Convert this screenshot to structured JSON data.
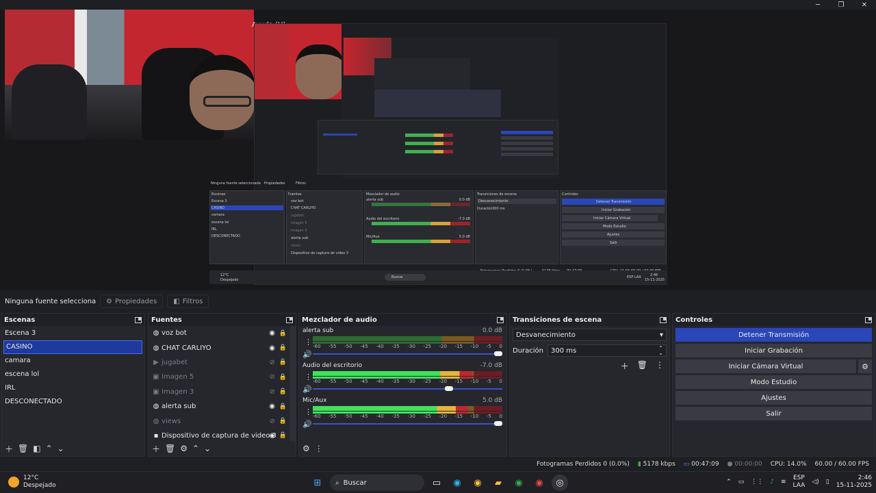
{
  "window": {
    "min": "─",
    "max": "❐",
    "close": "✕",
    "menu_help": "Ayuda (H)"
  },
  "preview": {
    "nested_menu": "Ayuda (H)",
    "nested_no_source": "Ninguna fuente seleccionada",
    "nested_props": "Propiedades",
    "nested_filters": "Filtros",
    "nested_scenes": "Escenas",
    "nested_sources": "Fuentes",
    "nested_mixer": "Mezclador de audio",
    "nested_transitions": "Transiciones de escena",
    "nested_controls": "Controles",
    "nested_btn_stop": "Detener Transmisión",
    "nested_btn_rec": "Iniciar Grabación",
    "nested_btn_vcam": "Iniciar Cámara Virtual",
    "nested_btn_studio": "Modo Estudio",
    "nested_btn_settings": "Ajustes",
    "nested_btn_exit": "Salir",
    "nested_fade": "Desvanecimiento",
    "nested_duration": "Duración",
    "nested_ms": "300 ms",
    "nested_status": "Fotogramas Perdidos 0 (0.0%)",
    "nested_kbps": "5178 kbps",
    "nested_time": "00:47:09",
    "nested_cpu": "CPU: 14.0%",
    "nested_fps": "60.00 / 60.00 FPS",
    "nested_search": "Buscar",
    "nested_temp": "12°C",
    "nested_weather": "Despejado",
    "nested_lang": "ESP LAA",
    "nested_clock_time": "2:46",
    "nested_clock_date": "15-11-2025",
    "nested_scenes_list": [
      "Escena 3",
      "CASINO",
      "camara",
      "escena lol",
      "IRL",
      "DESCONECTADO"
    ],
    "nested_sources_list": [
      "voz bot",
      "CHAT CARLIYO",
      "jugabet",
      "Imagen 5",
      "Imagen 3",
      "alerta sub",
      "views",
      "Dispositivo de captura de video 3"
    ],
    "nested_ch1": "alerta sub",
    "nested_ch1_db": "0.0 dB",
    "nested_ch2": "Audio del escritorio",
    "nested_ch2_db": "-7.0 dB",
    "nested_ch3": "Mic/Aux",
    "nested_ch3_db": "5.0 dB"
  },
  "source_toolbar": {
    "no_source": "Ninguna fuente seleccionada",
    "properties": "Propiedades",
    "filters": "Filtros"
  },
  "scenes": {
    "title": "Escenas",
    "items": [
      "Escena 3",
      "CASINO",
      "camara",
      "escena lol",
      "IRL",
      "DESCONECTADO"
    ],
    "selected_index": 1
  },
  "sources": {
    "title": "Fuentes",
    "items": [
      {
        "name": "voz bot",
        "icon": "browser-icon",
        "visible": true
      },
      {
        "name": "CHAT CARLIYO",
        "icon": "browser-icon",
        "visible": true
      },
      {
        "name": "jugabet",
        "icon": "media-icon",
        "visible": false
      },
      {
        "name": "Imagen 5",
        "icon": "image-icon",
        "visible": false
      },
      {
        "name": "Imagen 3",
        "icon": "image-icon",
        "visible": false
      },
      {
        "name": "alerta sub",
        "icon": "browser-icon",
        "visible": true
      },
      {
        "name": "views",
        "icon": "browser-icon",
        "visible": false
      },
      {
        "name": "Dispositivo de captura de video 3",
        "icon": "camera-icon",
        "visible": true
      }
    ]
  },
  "mixer": {
    "title": "Mezclador de audio",
    "scale": [
      "-60",
      "-55",
      "-50",
      "-45",
      "-40",
      "-35",
      "-30",
      "-25",
      "-20",
      "-15",
      "-10",
      "-5",
      "0"
    ],
    "channels": [
      {
        "name": "alerta sub",
        "db": "0.0 dB",
        "level": 0,
        "volume": 1.0
      },
      {
        "name": "Audio del escritorio",
        "db": "-7.0 dB",
        "level": 0.84,
        "volume": 0.74
      },
      {
        "name": "Mic/Aux",
        "db": "5.0 dB",
        "level": 0.82,
        "volume": 1.0
      }
    ]
  },
  "transitions": {
    "title": "Transiciones de escena",
    "selected": "Desvanecimiento",
    "duration_label": "Duración",
    "duration_value": "300 ms"
  },
  "controls": {
    "title": "Controles",
    "stop_stream": "Detener Transmisión",
    "start_recording": "Iniciar Grabación",
    "start_virtual_cam": "Iniciar Cámara Virtual",
    "studio_mode": "Modo Estudio",
    "settings": "Ajustes",
    "exit": "Salir"
  },
  "status": {
    "dropped": "Fotogramas Perdidos 0 (0.0%)",
    "kbps": "5178 kbps",
    "stream_time": "00:47:09",
    "rec_time": "00:00:00",
    "cpu": "CPU: 14.0%",
    "fps": "60.00 / 60.00 FPS"
  },
  "taskbar": {
    "temp": "12°C",
    "weather": "Despejado",
    "search": "Buscar",
    "lang1": "ESP",
    "lang2": "LAA",
    "time": "2:46",
    "date": "15-11-2025"
  },
  "colors": {
    "accent": "#2a46b8",
    "panel": "#26272d",
    "background": "#1e1f23"
  }
}
